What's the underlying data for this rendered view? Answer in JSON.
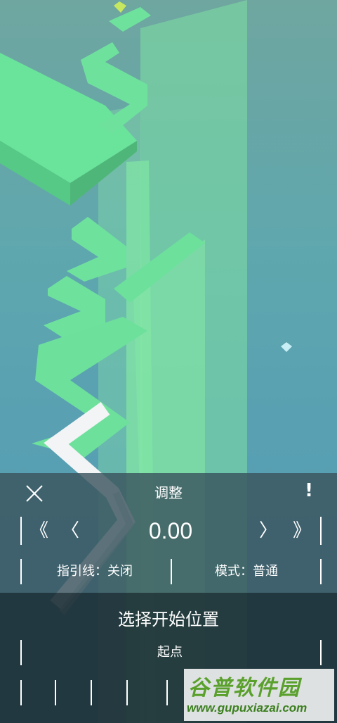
{
  "adjust_panel": {
    "title": "调整",
    "info_label": "!",
    "nav": {
      "fast_back": "《",
      "back": "〈",
      "forward": "〉",
      "fast_forward": "》"
    },
    "offset_value": "0.00",
    "guide_line": "指引线：关闭",
    "mode": "模式：普通"
  },
  "select_panel": {
    "title": "选择开始位置",
    "start_point": "起点",
    "marker_count": 9
  },
  "watermark": {
    "name": "谷普软件园",
    "url": "www.gupuxiazai.com"
  },
  "colors": {
    "sky": "#5fa7ae",
    "track": "#6de09c",
    "path": "#ffffff",
    "panel_top": "#3a545e",
    "panel_bottom": "#1e3036"
  }
}
